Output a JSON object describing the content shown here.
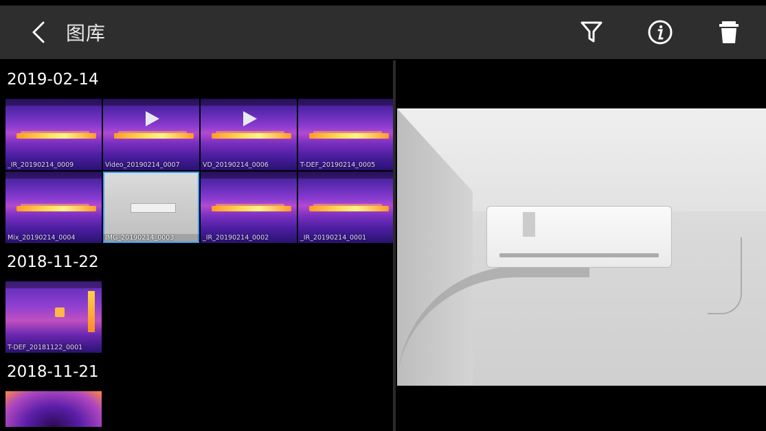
{
  "header": {
    "title": "图库",
    "icons": [
      "back-arrow-icon",
      "filter-icon",
      "info-icon",
      "trash-icon"
    ]
  },
  "gallery": {
    "groups": [
      {
        "date": "2019-02-14",
        "items": [
          {
            "label": "_IR_20190214_0009",
            "kind": "thermal"
          },
          {
            "label": "Video_20190214_0007",
            "kind": "thermal-video"
          },
          {
            "label": "VD_20190214_0006",
            "kind": "thermal-video"
          },
          {
            "label": "T-DEF_20190214_0005",
            "kind": "thermal"
          },
          {
            "label": "Mix_20190214_0004",
            "kind": "thermal"
          },
          {
            "label": "IMG_20190214_0003",
            "kind": "visible",
            "selected": true
          },
          {
            "label": "_IR_20190214_0002",
            "kind": "thermal"
          },
          {
            "label": "_IR_20190214_0001",
            "kind": "thermal"
          }
        ]
      },
      {
        "date": "2018-11-22",
        "items": [
          {
            "label": "T-DEF_20181122_0001",
            "kind": "thermal"
          }
        ]
      },
      {
        "date": "2018-11-21",
        "items": [
          {
            "label": "",
            "kind": "thermal"
          }
        ]
      }
    ]
  },
  "preview": {
    "image": "air-conditioner-photo"
  },
  "colors": {
    "header_bg": "#2e2e2e",
    "background": "#000000",
    "selected_outline": "#3aa0ff"
  }
}
